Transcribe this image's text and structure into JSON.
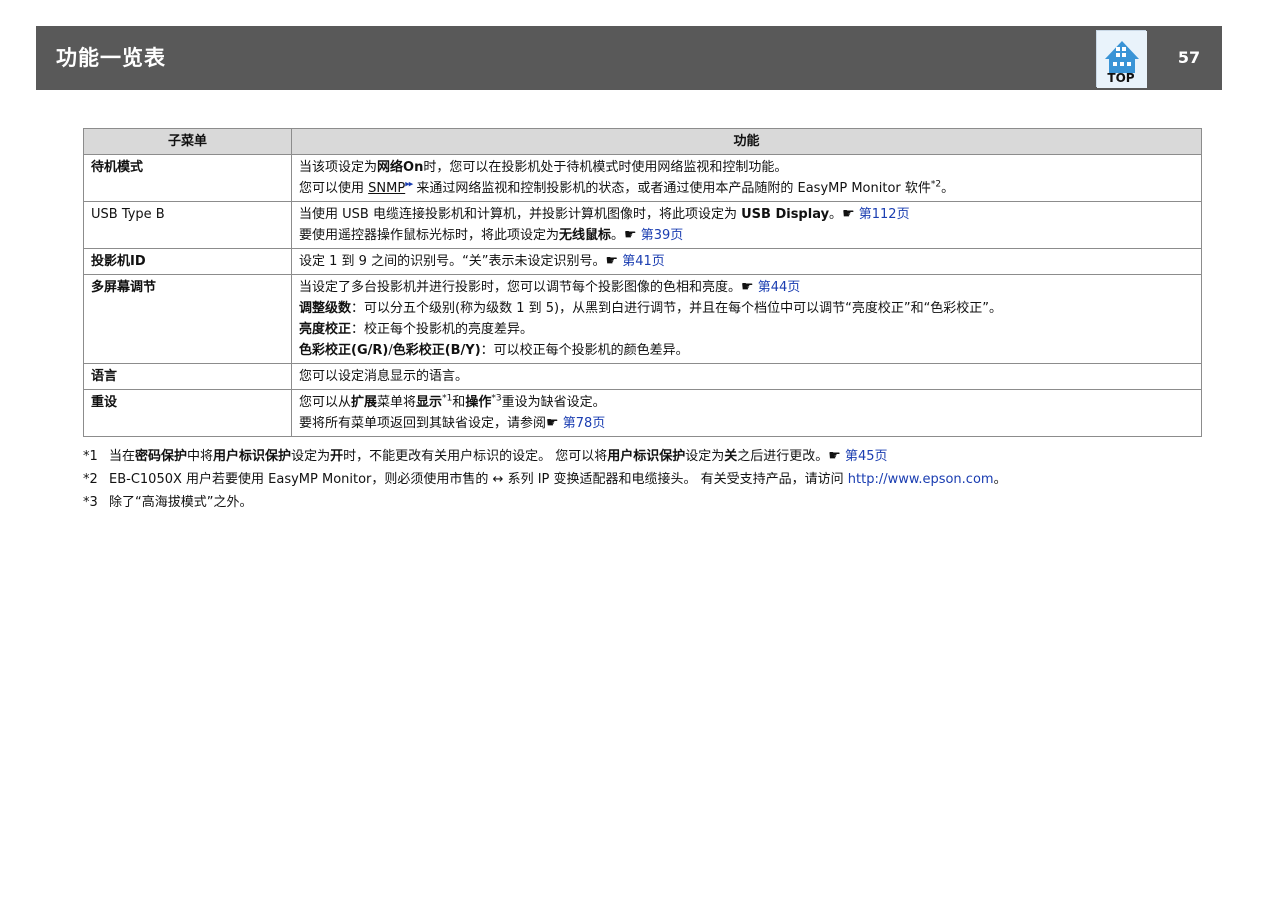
{
  "header": {
    "title": "功能一览表",
    "top_button_label": "TOP",
    "page_number": "57"
  },
  "table": {
    "col_submenu": "子菜单",
    "col_function": "功能",
    "rows": {
      "standby": {
        "name": "待机模式",
        "l1_a": "当该项设定为",
        "l1_b": "网络On",
        "l1_c": "时，您可以在投影机处于待机模式时使用网络监视和控制功能。",
        "l2_a": "您可以使用 ",
        "l2_snmp": "SNMP",
        "l2_arrow": "▸▸",
        "l2_b": " 来通过网络监视和控制投影机的状态，或者通过使用本产品随附的 EasyMP Monitor 软件",
        "l2_sup": "*2",
        "l2_end": "。"
      },
      "usb": {
        "name": "USB Type B",
        "l1_a": "当使用 USB 电缆连接投影机和计算机，并投影计算机图像时，将此项设定为 ",
        "l1_b": "USB Display",
        "l1_c": "。",
        "l1_hand": "☛",
        "l1_link": "第112页",
        "l2_a": "要使用遥控器操作鼠标光标时，将此项设定为",
        "l2_b": "无线鼠标",
        "l2_c": "。",
        "l2_hand": "☛",
        "l2_link": "第39页"
      },
      "projector_id": {
        "name": "投影机ID",
        "l1_a": "设定 1 到 9 之间的识别号。“关”表示未设定识别号。",
        "l1_hand": "☛",
        "l1_link": "第41页"
      },
      "multiscreen": {
        "name": "多屏幕调节",
        "l1_a": "当设定了多台投影机并进行投影时，您可以调节每个投影图像的色相和亮度。",
        "l1_hand": "☛",
        "l1_link": "第44页",
        "l2_b": "调整级数",
        "l2_a": "：可以分五个级别(称为级数 1 到 5)，从黑到白进行调节，并且在每个档位中可以调节“亮度校正”和“色彩校正”。",
        "l3_b": "亮度校正",
        "l3_a": "：校正每个投影机的亮度差异。",
        "l4_b1": "色彩校正(G/R)",
        "l4_sep": "/",
        "l4_b2": "色彩校正(B/Y)",
        "l4_a": "：可以校正每个投影机的颜色差异。"
      },
      "language": {
        "name": "语言",
        "l1_a": "您可以设定消息显示的语言。"
      },
      "reset": {
        "name": "重设",
        "l1_a": "您可以从",
        "l1_b": "扩展",
        "l1_c": "菜单将",
        "l1_d": "显示",
        "l1_sup1": "*1",
        "l1_e": "和",
        "l1_f": "操作",
        "l1_sup3": "*3",
        "l1_g": "重设为缺省设定。",
        "l2_a": "要将所有菜单项返回到其缺省设定，请参阅",
        "l2_hand": "☛",
        "l2_link": "第78页"
      }
    }
  },
  "notes": {
    "n1_mark": "*1",
    "n1_a": "当在",
    "n1_b": "密码保护",
    "n1_c": "中将",
    "n1_d": "用户标识保护",
    "n1_e": "设定为",
    "n1_f": "开",
    "n1_g": "时，不能更改有关用户标识的设定。 您可以将",
    "n1_h": "用户标识保护",
    "n1_i": "设定为",
    "n1_j": "关",
    "n1_k": "之后进行更改。",
    "n1_hand": "☛",
    "n1_link": "第45页",
    "n2_mark": "*2",
    "n2_a": "EB-C1050X 用户若要使用 EasyMP Monitor，则必须使用市售的 ",
    "n2_arrow": "↔",
    "n2_b": " 系列 IP 变换适配器和电缆接头。 有关受支持产品，请访问 ",
    "n2_link": "http://www.epson.com",
    "n2_end": "。",
    "n3_mark": "*3",
    "n3_a": "除了“高海拔模式”之外。"
  }
}
